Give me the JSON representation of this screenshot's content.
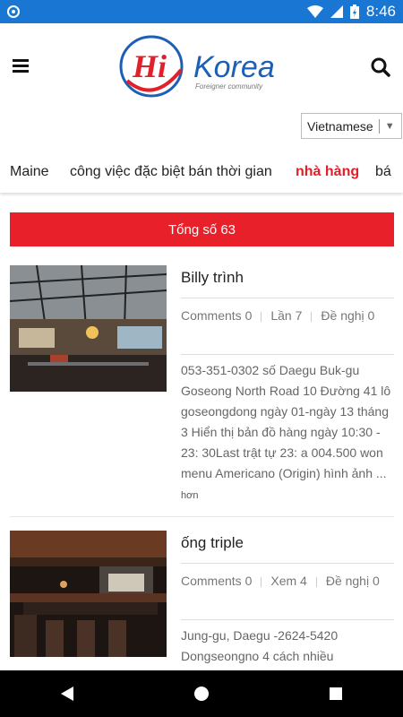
{
  "status_bar": {
    "time": "8:46"
  },
  "header": {
    "logo_text": "Hi",
    "logo_brand": "Korea",
    "logo_tagline": "Foreigner community"
  },
  "language": {
    "selected": "Vietnamese"
  },
  "tabs": [
    {
      "label": "Maine",
      "active": false
    },
    {
      "label": "công việc đặc biệt bán thời gian",
      "active": false
    },
    {
      "label": "nhà hàng",
      "active": true
    },
    {
      "label": "bá",
      "active": false
    }
  ],
  "total": {
    "label": "Tổng số 63"
  },
  "items": [
    {
      "title": "Billy trình",
      "comments": "Comments 0",
      "views": "Lần 7",
      "recommend": "Đề nghị 0",
      "description": "053-351-0302 số Daegu Buk-gu Goseong North Road 10 Đường 41 lô goseongdong ngày 01-ngày 13 tháng 3 Hiển thị bản đồ hàng ngày 10:30 - 23: 30Last trật tự 23: a 004.500 won menu Americano (Origin) hình ảnh ...",
      "more": "hơn"
    },
    {
      "title": "ống triple",
      "comments": "Comments 0",
      "views": "Xem 4",
      "recommend": "Đề nghị 0",
      "description": "Jung-gu, Daegu -2624-5420 Dongseongno 4 cách nhiều",
      "more": ""
    }
  ],
  "colors": {
    "accent": "#e8202a",
    "status_bar": "#1976d2",
    "logo_blue": "#1c5fb6",
    "logo_red": "#e0202a"
  }
}
